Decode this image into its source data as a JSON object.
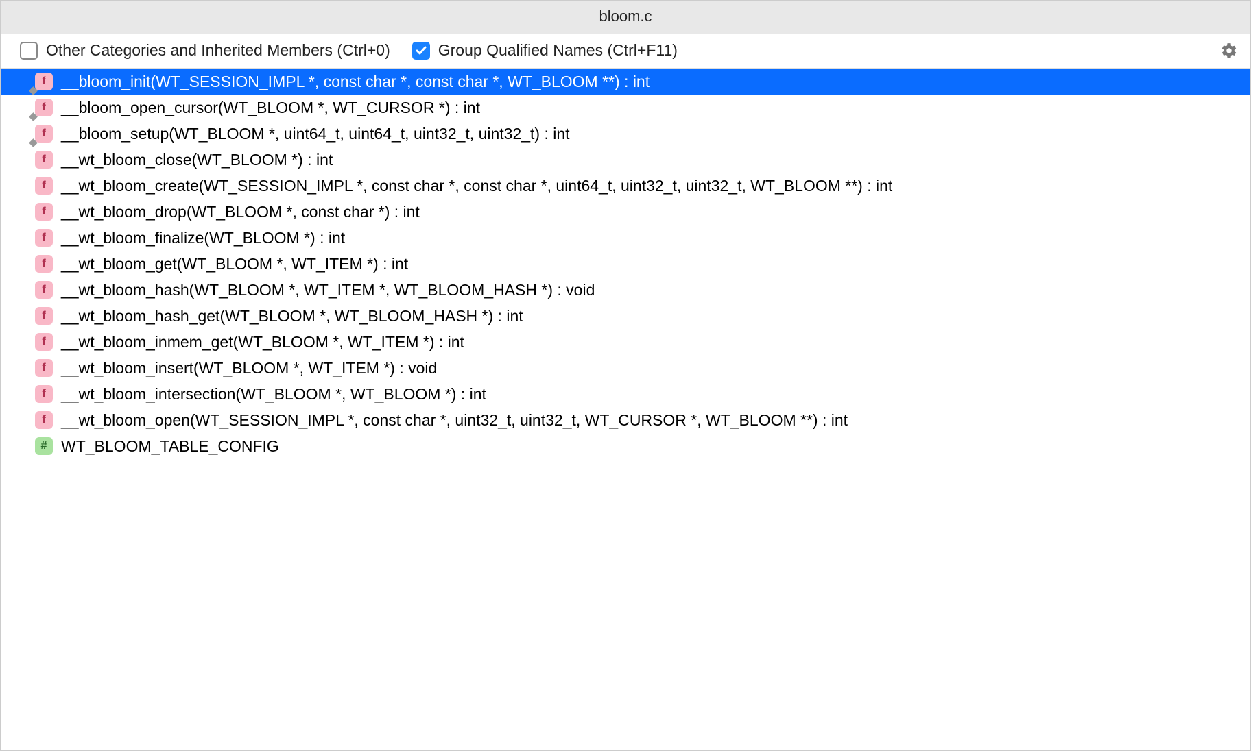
{
  "title": "bloom.c",
  "options": {
    "other_categories": {
      "label": "Other Categories and Inherited Members (Ctrl+0)",
      "checked": false
    },
    "group_qualified": {
      "label": "Group Qualified Names (Ctrl+F11)",
      "checked": true
    }
  },
  "items": [
    {
      "icon": "f",
      "overlay": true,
      "selected": true,
      "label": "__bloom_init(WT_SESSION_IMPL *, const char *, const char *, WT_BLOOM **) : int"
    },
    {
      "icon": "f",
      "overlay": true,
      "selected": false,
      "label": "__bloom_open_cursor(WT_BLOOM *, WT_CURSOR *) : int"
    },
    {
      "icon": "f",
      "overlay": true,
      "selected": false,
      "label": "__bloom_setup(WT_BLOOM *, uint64_t, uint64_t, uint32_t, uint32_t) : int"
    },
    {
      "icon": "f",
      "overlay": false,
      "selected": false,
      "label": "__wt_bloom_close(WT_BLOOM *) : int"
    },
    {
      "icon": "f",
      "overlay": false,
      "selected": false,
      "label": "__wt_bloom_create(WT_SESSION_IMPL *, const char *, const char *, uint64_t, uint32_t, uint32_t, WT_BLOOM **) : int"
    },
    {
      "icon": "f",
      "overlay": false,
      "selected": false,
      "label": "__wt_bloom_drop(WT_BLOOM *, const char *) : int"
    },
    {
      "icon": "f",
      "overlay": false,
      "selected": false,
      "label": "__wt_bloom_finalize(WT_BLOOM *) : int"
    },
    {
      "icon": "f",
      "overlay": false,
      "selected": false,
      "label": "__wt_bloom_get(WT_BLOOM *, WT_ITEM *) : int"
    },
    {
      "icon": "f",
      "overlay": false,
      "selected": false,
      "label": "__wt_bloom_hash(WT_BLOOM *, WT_ITEM *, WT_BLOOM_HASH *) : void"
    },
    {
      "icon": "f",
      "overlay": false,
      "selected": false,
      "label": "__wt_bloom_hash_get(WT_BLOOM *, WT_BLOOM_HASH *) : int"
    },
    {
      "icon": "f",
      "overlay": false,
      "selected": false,
      "label": "__wt_bloom_inmem_get(WT_BLOOM *, WT_ITEM *) : int"
    },
    {
      "icon": "f",
      "overlay": false,
      "selected": false,
      "label": "__wt_bloom_insert(WT_BLOOM *, WT_ITEM *) : void"
    },
    {
      "icon": "f",
      "overlay": false,
      "selected": false,
      "label": "__wt_bloom_intersection(WT_BLOOM *, WT_BLOOM *) : int"
    },
    {
      "icon": "f",
      "overlay": false,
      "selected": false,
      "label": "__wt_bloom_open(WT_SESSION_IMPL *, const char *, uint32_t, uint32_t, WT_CURSOR *, WT_BLOOM **) : int"
    },
    {
      "icon": "#",
      "overlay": false,
      "selected": false,
      "label": "WT_BLOOM_TABLE_CONFIG"
    }
  ],
  "icon_glyphs": {
    "f": "f",
    "#": "#"
  }
}
